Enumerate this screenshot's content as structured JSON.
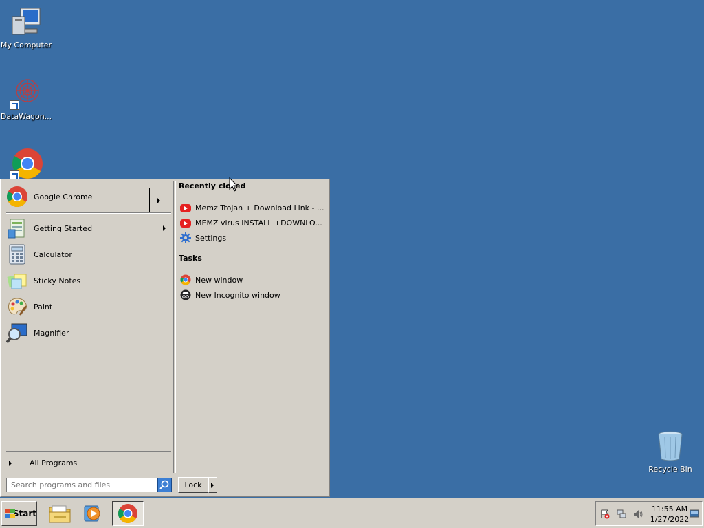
{
  "desktop": {
    "icons": [
      {
        "label": "My Computer",
        "icon": "computer-icon"
      },
      {
        "label": "DataWagon...",
        "icon": "datawagon-icon"
      },
      {
        "label": "",
        "icon": "chrome-icon"
      }
    ],
    "recycle_bin": {
      "label": "Recycle Bin",
      "icon": "recycle-bin-icon"
    },
    "background_color": "#3a6ea5"
  },
  "start_menu": {
    "pinned": {
      "label": "Google Chrome",
      "icon": "chrome-icon"
    },
    "programs": [
      {
        "label": "Getting Started",
        "icon": "getting-started-icon",
        "has_submenu": true
      },
      {
        "label": "Calculator",
        "icon": "calculator-icon"
      },
      {
        "label": "Sticky Notes",
        "icon": "sticky-notes-icon"
      },
      {
        "label": "Paint",
        "icon": "paint-icon"
      },
      {
        "label": "Magnifier",
        "icon": "magnifier-icon"
      }
    ],
    "all_programs": "All Programs",
    "search_placeholder": "Search programs and files",
    "lock_label": "Lock",
    "jump_list": {
      "recent_title": "Recently closed",
      "recent": [
        {
          "label": "Memz Trojan + Download Link - ...",
          "icon": "youtube-icon"
        },
        {
          "label": "MEMZ virus INSTALL +DOWNLO...",
          "icon": "youtube-icon"
        },
        {
          "label": "Settings",
          "icon": "gear-icon"
        }
      ],
      "tasks_title": "Tasks",
      "tasks": [
        {
          "label": "New window",
          "icon": "chrome-icon"
        },
        {
          "label": "New Incognito window",
          "icon": "incognito-icon"
        }
      ]
    }
  },
  "taskbar": {
    "start_label": "Start",
    "apps": [
      {
        "name": "explorer",
        "icon": "folder-icon"
      },
      {
        "name": "media-player",
        "icon": "media-player-icon"
      },
      {
        "name": "chrome",
        "icon": "chrome-icon",
        "active": true
      }
    ],
    "clock": {
      "time": "11:55 AM",
      "date": "1/27/2022"
    }
  }
}
